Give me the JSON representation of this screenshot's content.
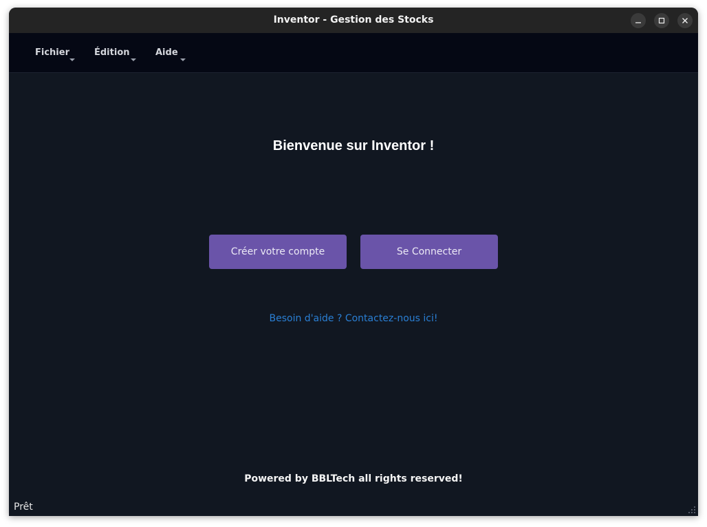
{
  "window": {
    "title": "Inventor - Gestion des Stocks",
    "controls": [
      "minimize-icon",
      "maximize-icon",
      "close-icon"
    ]
  },
  "menubar": {
    "items": [
      {
        "label": "Fichier"
      },
      {
        "label": "Édition"
      },
      {
        "label": "Aide"
      }
    ]
  },
  "main": {
    "heading": "Bienvenue sur Inventor !",
    "create_account_label": "Créer votre compte",
    "login_label": "Se Connecter",
    "help_link": "Besoin d'aide ? Contactez-nous ici!",
    "footer": "Powered by BBLTech all rights reserved!"
  },
  "statusbar": {
    "text": "Prêt"
  },
  "colors": {
    "background": "#111721",
    "menubar": "#050814",
    "button": "#6a54a9",
    "link": "#2a7fd4"
  }
}
